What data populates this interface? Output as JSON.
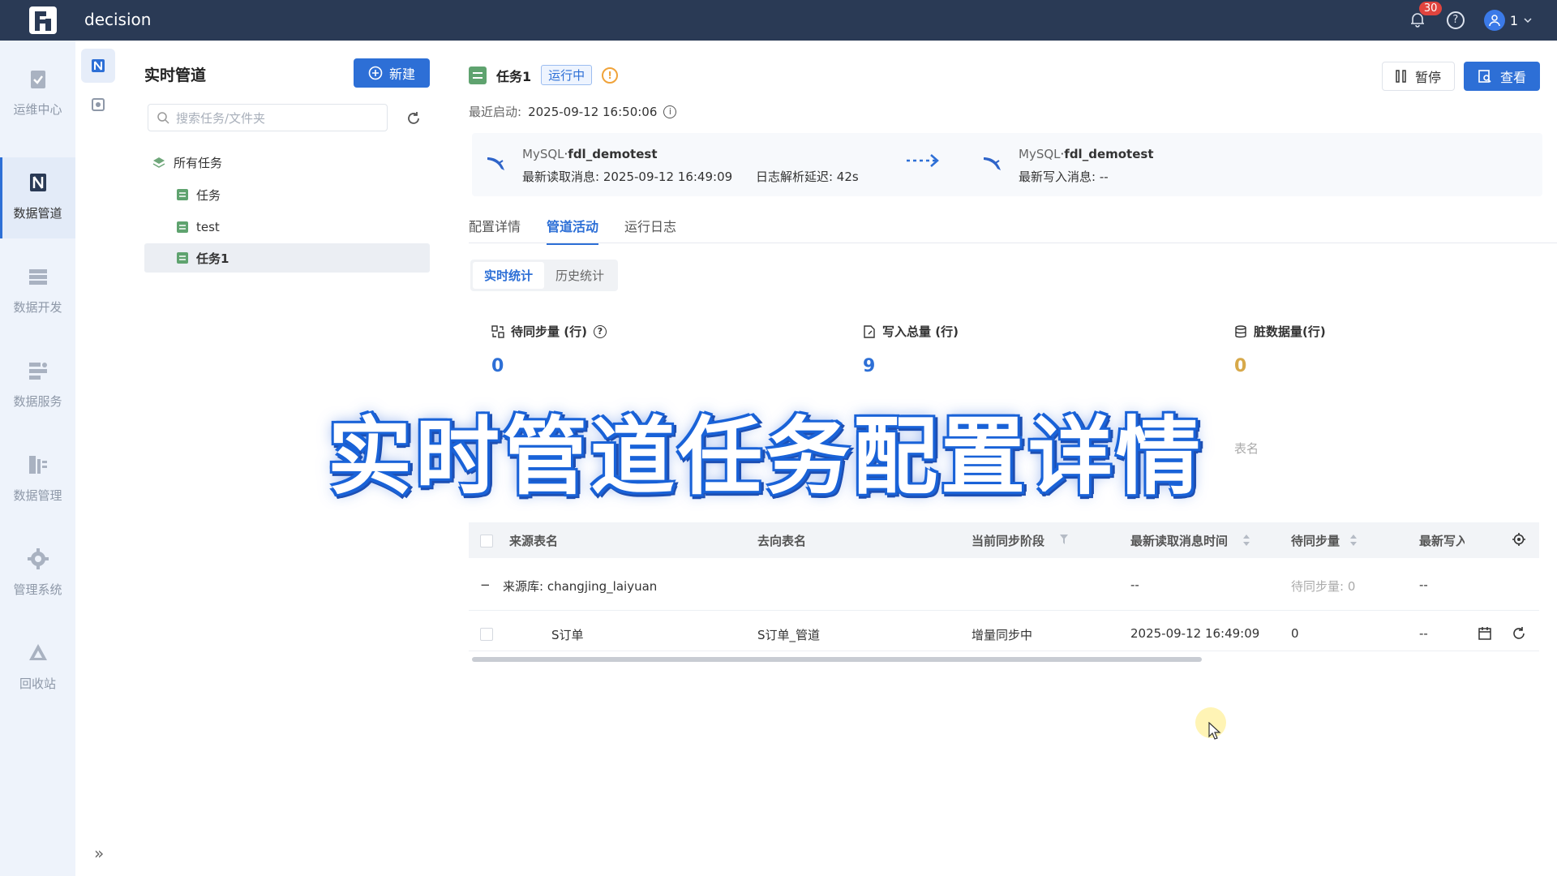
{
  "app": {
    "title": "decision",
    "notifications": "30",
    "user": "1"
  },
  "rail": {
    "items": [
      {
        "label": "运维中心",
        "icon": "clipboard-check-icon"
      },
      {
        "label": "数据管道",
        "icon": "pipeline-icon"
      },
      {
        "label": "数据开发",
        "icon": "dev-icon"
      },
      {
        "label": "数据服务",
        "icon": "service-icon"
      },
      {
        "label": "数据管理",
        "icon": "data-manage-icon"
      },
      {
        "label": "管理系统",
        "icon": "gear-icon"
      },
      {
        "label": "回收站",
        "icon": "recycle-icon"
      }
    ],
    "expand": "»"
  },
  "tree": {
    "title": "实时管道",
    "new_button": "新建",
    "search_placeholder": "搜索任务/文件夹",
    "root": "所有任务",
    "nodes": [
      "任务",
      "test",
      "任务1"
    ]
  },
  "task": {
    "name": "任务1",
    "status": "运行中",
    "pause": "暂停",
    "view": "查看",
    "last_start_label": "最近启动:",
    "last_start_value": "2025-09-12 16:50:06"
  },
  "flow": {
    "source": {
      "db_type": "MySQL",
      "db_name": "fdl_demotest",
      "read_label": "最新读取消息:",
      "read_value": "2025-09-12 16:49:09",
      "delay_label": "日志解析延迟:",
      "delay_value": "42s"
    },
    "target": {
      "db_type": "MySQL",
      "db_name": "fdl_demotest",
      "write_label": "最新写入消息:",
      "write_value": "--"
    }
  },
  "tabs": [
    "配置详情",
    "管道活动",
    "运行日志"
  ],
  "subtabs": [
    "实时统计",
    "历史统计"
  ],
  "stats": [
    {
      "label": "待同步量 (行)",
      "value": "0"
    },
    {
      "label": "写入总量 (行)",
      "value": "9"
    },
    {
      "label": "脏数据量(行)",
      "value": "0"
    }
  ],
  "table": {
    "headers": [
      "来源表名",
      "去向表名",
      "当前同步阶段",
      "最新读取消息时间",
      "待同步量",
      "最新写入"
    ],
    "group": {
      "label": "来源库:",
      "value": "changjing_laiyuan",
      "read": "--",
      "pending": "待同步量: 0",
      "write": "--"
    },
    "rows": [
      {
        "source": "S订单",
        "target": "S订单_管道",
        "stage": "增量同步中",
        "read_time": "2025-09-12 16:49:09",
        "pending": "0",
        "write": "--"
      }
    ],
    "partial_hint": "表名"
  },
  "overlay": "实时管道任务配置详情"
}
